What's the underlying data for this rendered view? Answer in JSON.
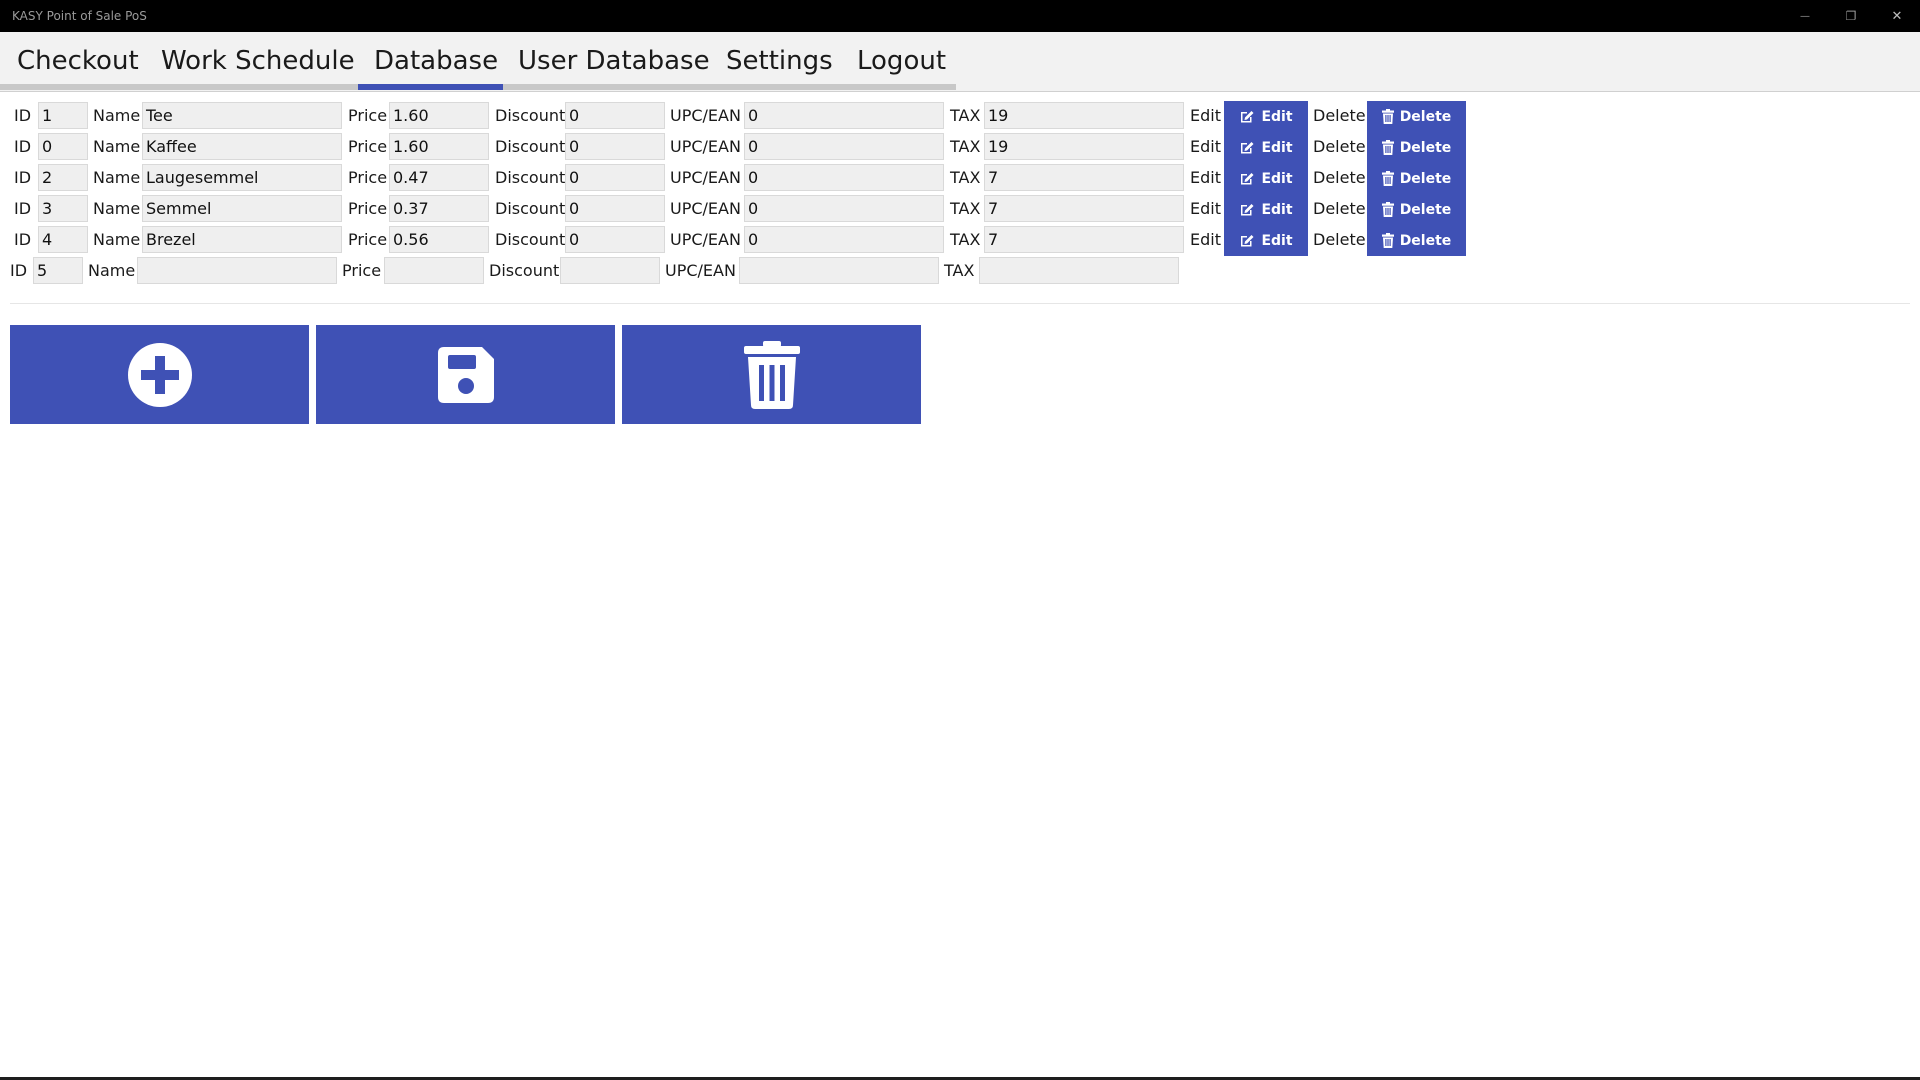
{
  "window": {
    "title": "KASY Point of Sale PoS",
    "minimize_glyph": "—",
    "maximize_glyph": "❐",
    "close_glyph": "✕"
  },
  "menu": {
    "items": [
      {
        "label": "Checkout"
      },
      {
        "label": "Work Schedule"
      },
      {
        "label": "Database"
      },
      {
        "label": "User Database"
      },
      {
        "label": "Settings"
      },
      {
        "label": "Logout"
      }
    ],
    "active": "Database"
  },
  "labels": {
    "id": "ID",
    "name": "Name",
    "price": "Price",
    "discount": "Discount",
    "upc": "UPC/EAN",
    "tax": "TAX",
    "edit": "Edit",
    "delete": "Delete",
    "edit_button": "Edit",
    "delete_button": "Delete"
  },
  "products": [
    {
      "id": "1",
      "name": "Tee",
      "price": "1.60",
      "discount": "0",
      "upc": "0",
      "tax": "19"
    },
    {
      "id": "0",
      "name": "Kaffee",
      "price": "1.60",
      "discount": "0",
      "upc": "0",
      "tax": "19"
    },
    {
      "id": "2",
      "name": "Laugesemmel",
      "price": "0.47",
      "discount": "0",
      "upc": "0",
      "tax": "7"
    },
    {
      "id": "3",
      "name": "Semmel",
      "price": "0.37",
      "discount": "0",
      "upc": "0",
      "tax": "7"
    },
    {
      "id": "4",
      "name": "Brezel",
      "price": "0.56",
      "discount": "0",
      "upc": "0",
      "tax": "7"
    }
  ],
  "new_product": {
    "id": "5",
    "name": "",
    "price": "",
    "discount": "",
    "upc": "",
    "tax": ""
  },
  "actions": [
    {
      "icon": "plus-circle-icon"
    },
    {
      "icon": "save-icon"
    },
    {
      "icon": "trash-icon"
    }
  ],
  "colors": {
    "accent": "#3f51b5",
    "titlebar": "#000000",
    "menubar": "#f2f2f2",
    "field_bg": "#efefef"
  }
}
